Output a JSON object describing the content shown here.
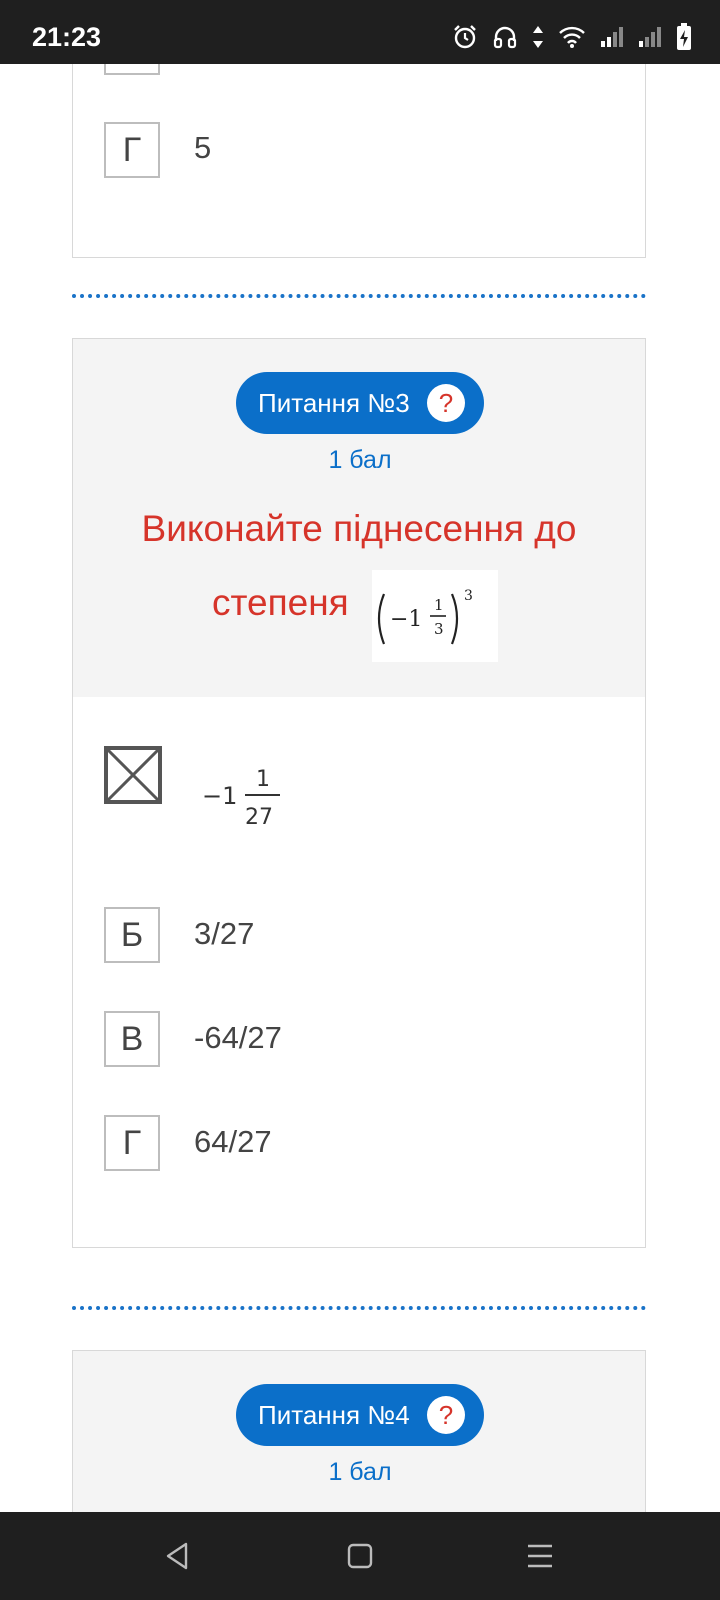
{
  "status_bar": {
    "time": "21:23",
    "icons": [
      "alarm-icon",
      "headphones-icon",
      "data-arrows-icon",
      "wifi-icon",
      "signal-icon",
      "signal-icon",
      "battery-charging-icon"
    ]
  },
  "prev_question": {
    "option": {
      "letter": "Г",
      "text": "5"
    }
  },
  "question3": {
    "pill_label": "Питання №3",
    "help_symbol": "?",
    "points": "1 бал",
    "task_line1": "Виконайте піднесення до",
    "task_line2": "степеня",
    "formula": {
      "sign": "−1",
      "numerator": "1",
      "denominator": "3",
      "exponent": "3"
    },
    "options": [
      {
        "letter": "А",
        "selected": true,
        "whole": "−1",
        "numerator": "1",
        "denominator": "27"
      },
      {
        "letter": "Б",
        "text": "3/27"
      },
      {
        "letter": "В",
        "text": "-64/27"
      },
      {
        "letter": "Г",
        "text": "64/27"
      }
    ]
  },
  "question4": {
    "pill_label": "Питання №4",
    "help_symbol": "?",
    "points": "1 бал"
  },
  "colors": {
    "accent": "#0b6fc9",
    "task_text": "#d6342a",
    "status_bar": "#1f1f1f",
    "card_header": "#f4f4f4"
  }
}
